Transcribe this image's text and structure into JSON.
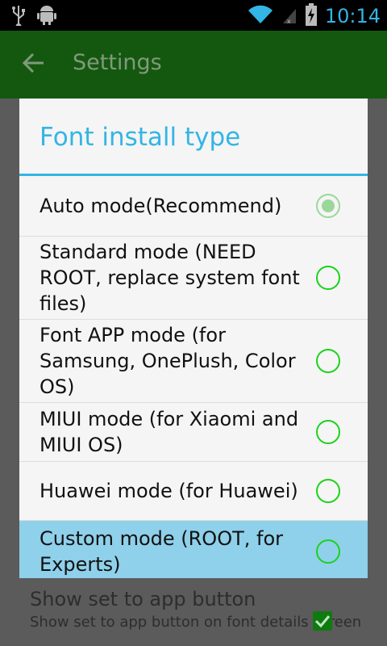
{
  "status_bar": {
    "time": "10:14",
    "icons": [
      "usb-icon",
      "android-debug-icon",
      "wifi-icon",
      "signal-icon",
      "battery-charging-icon"
    ]
  },
  "app_bar": {
    "title": "Settings",
    "back_icon": "arrow-back-icon"
  },
  "dialog": {
    "title": "Font install type",
    "accent": "#33b5e5",
    "options": [
      {
        "label": "Auto mode(Recommend)",
        "selected": true
      },
      {
        "label": "Standard mode (NEED ROOT, replace system font files)",
        "selected": false
      },
      {
        "label": "Font APP mode (for Samsung, OnePlush, Color OS)",
        "selected": false
      },
      {
        "label": "MIUI mode (for Xiaomi and MIUI OS)",
        "selected": false
      },
      {
        "label": "Huawei mode (for Huawei)",
        "selected": false
      },
      {
        "label": "Custom mode (ROOT, for Experts)",
        "selected": false,
        "highlighted": true
      }
    ]
  },
  "background_setting": {
    "title": "Show set to app button",
    "summary": "Show set to app button on font details screen",
    "checked": true
  }
}
